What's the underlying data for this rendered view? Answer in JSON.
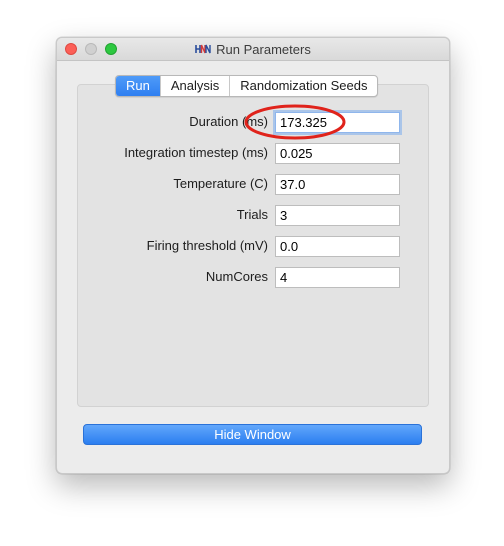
{
  "window": {
    "title": "Run Parameters",
    "app_icon": "hnn-logo-icon"
  },
  "tabs": [
    {
      "label": "Run",
      "active": true
    },
    {
      "label": "Analysis",
      "active": false
    },
    {
      "label": "Randomization Seeds",
      "active": false
    }
  ],
  "fields": [
    {
      "label": "Duration (ms)",
      "value": "173.325"
    },
    {
      "label": "Integration timestep (ms)",
      "value": "0.025"
    },
    {
      "label": "Temperature (C)",
      "value": "37.0"
    },
    {
      "label": "Trials",
      "value": "3"
    },
    {
      "label": "Firing threshold (mV)",
      "value": "0.0"
    },
    {
      "label": "NumCores",
      "value": "4"
    }
  ],
  "footer": {
    "hide_button_label": "Hide Window"
  },
  "colors": {
    "accent": "#2f7ff1",
    "annotation": "#e0231b"
  }
}
